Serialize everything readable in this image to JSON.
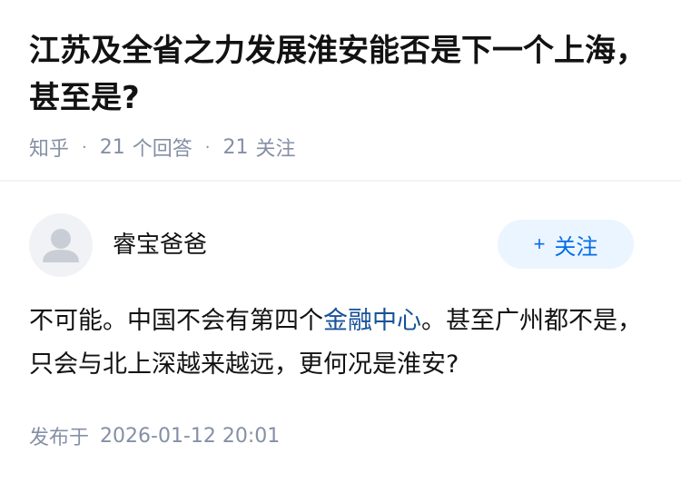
{
  "question": {
    "title": "江苏及全省之力发展淮安能否是下一个上海，甚至是?",
    "source": "知乎",
    "answer_count": "21",
    "answer_label": "个回答",
    "follower_count": "21",
    "follower_label": "关注",
    "separator": "·"
  },
  "author": {
    "name": "睿宝爸爸",
    "avatar_icon": "default-avatar-icon",
    "follow_plus": "+",
    "follow_label": "关注"
  },
  "answer": {
    "text_before_link": "不可能。中国不会有第四个",
    "link_text": "金融中心",
    "text_after_link": "。甚至广州都不是，只会与北上深越来越远，更何况是淮安?"
  },
  "publish": {
    "label": "发布于",
    "datetime": "2026-01-12 20:01"
  },
  "colors": {
    "meta_gray": "#8590a6",
    "link_blue": "#175199",
    "follow_blue": "#056de8",
    "follow_bg": "#ebf5ff"
  }
}
